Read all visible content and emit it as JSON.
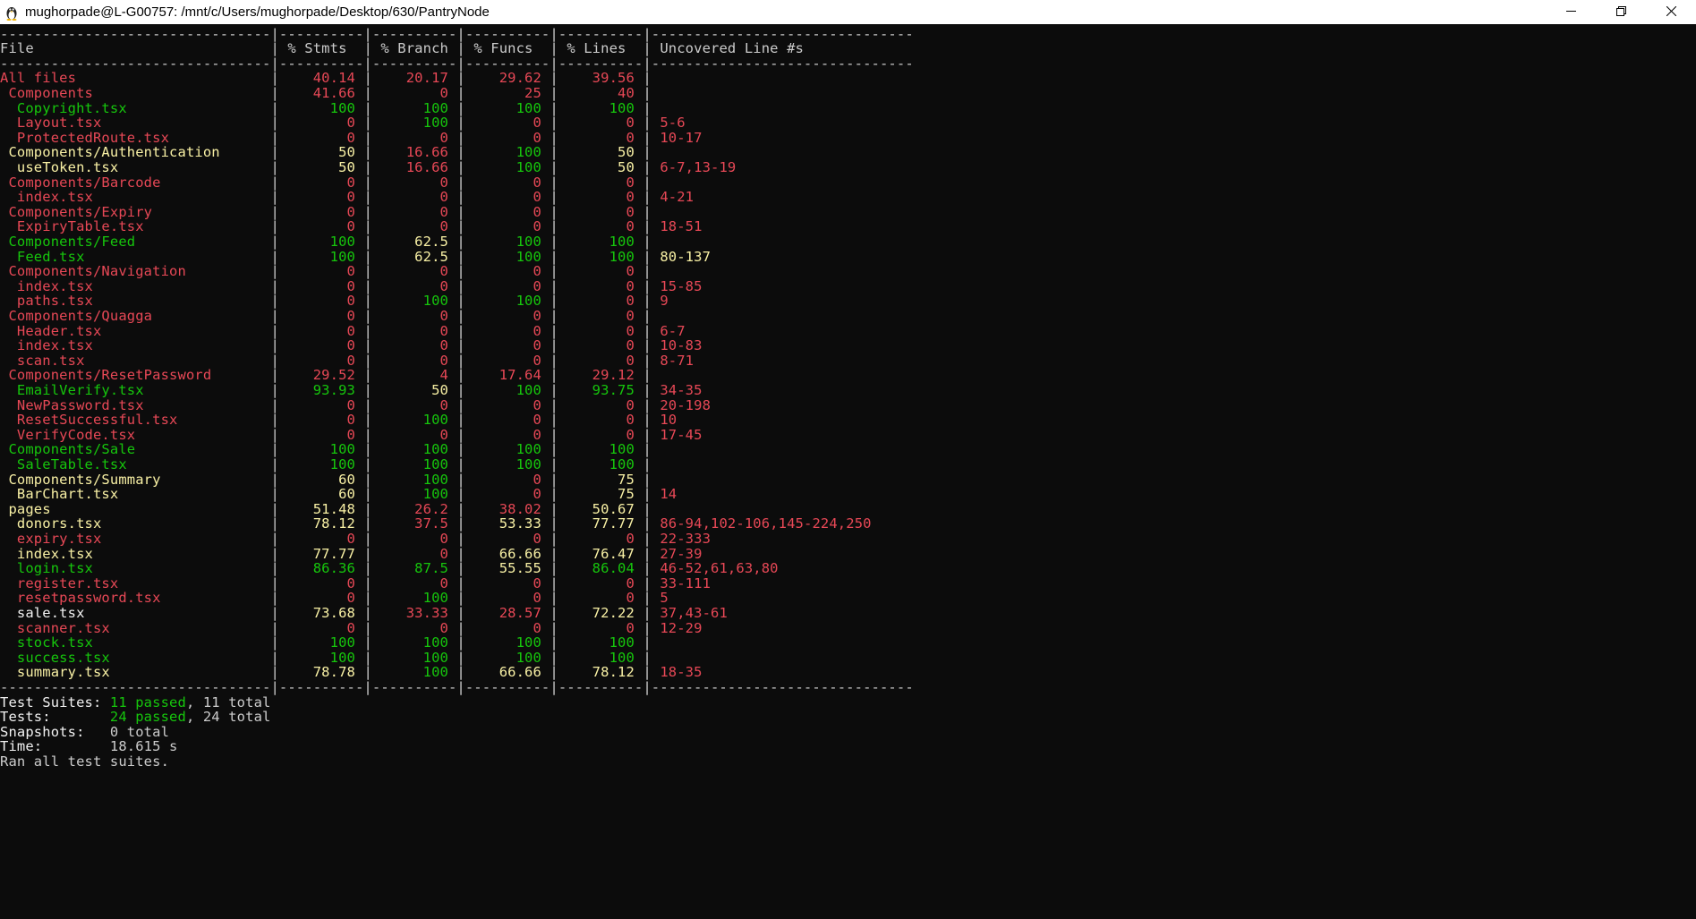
{
  "window": {
    "title": "mughorpade@L-G00757: /mnt/c/Users/mughorpade/Desktop/630/PantryNode",
    "icon": "linux-penguin-icon",
    "controls": [
      "minimize-icon",
      "restore-icon",
      "close-icon"
    ]
  },
  "colors": {
    "red": "#e74856",
    "green": "#16c60c",
    "yellow": "#f9f1a5",
    "white": "#f2f2f2",
    "gray": "#cccccc",
    "background": "#0c0c0c"
  },
  "table": {
    "separator": "--------------------------------|----------|----------|----------|----------|-------------------------------",
    "headers": [
      "File",
      "% Stmts",
      "% Branch",
      "% Funcs",
      "% Lines",
      "Uncovered Line #s"
    ],
    "rows": [
      {
        "file": "All files",
        "indent": 0,
        "c": "red",
        "stmts": "40.14",
        "sc": "red",
        "branch": "20.17",
        "bc": "red",
        "funcs": "29.62",
        "fc": "red",
        "lines": "39.56",
        "lc": "red",
        "uncovered": ""
      },
      {
        "file": "Components",
        "indent": 1,
        "c": "red",
        "stmts": "41.66",
        "sc": "red",
        "branch": "0",
        "bc": "red",
        "funcs": "25",
        "fc": "red",
        "lines": "40",
        "lc": "red",
        "uncovered": ""
      },
      {
        "file": "Copyright.tsx",
        "indent": 2,
        "c": "green",
        "stmts": "100",
        "sc": "green",
        "branch": "100",
        "bc": "green",
        "funcs": "100",
        "fc": "green",
        "lines": "100",
        "lc": "green",
        "uncovered": ""
      },
      {
        "file": "Layout.tsx",
        "indent": 2,
        "c": "red",
        "stmts": "0",
        "sc": "red",
        "branch": "100",
        "bc": "green",
        "funcs": "0",
        "fc": "red",
        "lines": "0",
        "lc": "red",
        "uncovered": "5-6"
      },
      {
        "file": "ProtectedRoute.tsx",
        "indent": 2,
        "c": "red",
        "stmts": "0",
        "sc": "red",
        "branch": "0",
        "bc": "red",
        "funcs": "0",
        "fc": "red",
        "lines": "0",
        "lc": "red",
        "uncovered": "10-17"
      },
      {
        "file": "Components/Authentication",
        "indent": 1,
        "c": "yellow",
        "stmts": "50",
        "sc": "yellow",
        "branch": "16.66",
        "bc": "red",
        "funcs": "100",
        "fc": "green",
        "lines": "50",
        "lc": "yellow",
        "uncovered": ""
      },
      {
        "file": "useToken.tsx",
        "indent": 2,
        "c": "yellow",
        "stmts": "50",
        "sc": "yellow",
        "branch": "16.66",
        "bc": "red",
        "funcs": "100",
        "fc": "green",
        "lines": "50",
        "lc": "yellow",
        "uncovered": "6-7,13-19"
      },
      {
        "file": "Components/Barcode",
        "indent": 1,
        "c": "red",
        "stmts": "0",
        "sc": "red",
        "branch": "0",
        "bc": "red",
        "funcs": "0",
        "fc": "red",
        "lines": "0",
        "lc": "red",
        "uncovered": ""
      },
      {
        "file": "index.tsx",
        "indent": 2,
        "c": "red",
        "stmts": "0",
        "sc": "red",
        "branch": "0",
        "bc": "red",
        "funcs": "0",
        "fc": "red",
        "lines": "0",
        "lc": "red",
        "uncovered": "4-21"
      },
      {
        "file": "Components/Expiry",
        "indent": 1,
        "c": "red",
        "stmts": "0",
        "sc": "red",
        "branch": "0",
        "bc": "red",
        "funcs": "0",
        "fc": "red",
        "lines": "0",
        "lc": "red",
        "uncovered": ""
      },
      {
        "file": "ExpiryTable.tsx",
        "indent": 2,
        "c": "red",
        "stmts": "0",
        "sc": "red",
        "branch": "0",
        "bc": "red",
        "funcs": "0",
        "fc": "red",
        "lines": "0",
        "lc": "red",
        "uncovered": "18-51"
      },
      {
        "file": "Components/Feed",
        "indent": 1,
        "c": "green",
        "stmts": "100",
        "sc": "green",
        "branch": "62.5",
        "bc": "yellow",
        "funcs": "100",
        "fc": "green",
        "lines": "100",
        "lc": "green",
        "uncovered": ""
      },
      {
        "file": "Feed.tsx",
        "indent": 2,
        "c": "green",
        "stmts": "100",
        "sc": "green",
        "branch": "62.5",
        "bc": "yellow",
        "funcs": "100",
        "fc": "green",
        "lines": "100",
        "lc": "green",
        "uncovered": "80-137",
        "uc": "yellow"
      },
      {
        "file": "Components/Navigation",
        "indent": 1,
        "c": "red",
        "stmts": "0",
        "sc": "red",
        "branch": "0",
        "bc": "red",
        "funcs": "0",
        "fc": "red",
        "lines": "0",
        "lc": "red",
        "uncovered": ""
      },
      {
        "file": "index.tsx",
        "indent": 2,
        "c": "red",
        "stmts": "0",
        "sc": "red",
        "branch": "0",
        "bc": "red",
        "funcs": "0",
        "fc": "red",
        "lines": "0",
        "lc": "red",
        "uncovered": "15-85"
      },
      {
        "file": "paths.tsx",
        "indent": 2,
        "c": "red",
        "stmts": "0",
        "sc": "red",
        "branch": "100",
        "bc": "green",
        "funcs": "100",
        "fc": "green",
        "lines": "0",
        "lc": "red",
        "uncovered": "9"
      },
      {
        "file": "Components/Quagga",
        "indent": 1,
        "c": "red",
        "stmts": "0",
        "sc": "red",
        "branch": "0",
        "bc": "red",
        "funcs": "0",
        "fc": "red",
        "lines": "0",
        "lc": "red",
        "uncovered": ""
      },
      {
        "file": "Header.tsx",
        "indent": 2,
        "c": "red",
        "stmts": "0",
        "sc": "red",
        "branch": "0",
        "bc": "red",
        "funcs": "0",
        "fc": "red",
        "lines": "0",
        "lc": "red",
        "uncovered": "6-7"
      },
      {
        "file": "index.tsx",
        "indent": 2,
        "c": "red",
        "stmts": "0",
        "sc": "red",
        "branch": "0",
        "bc": "red",
        "funcs": "0",
        "fc": "red",
        "lines": "0",
        "lc": "red",
        "uncovered": "10-83"
      },
      {
        "file": "scan.tsx",
        "indent": 2,
        "c": "red",
        "stmts": "0",
        "sc": "red",
        "branch": "0",
        "bc": "red",
        "funcs": "0",
        "fc": "red",
        "lines": "0",
        "lc": "red",
        "uncovered": "8-71"
      },
      {
        "file": "Components/ResetPassword",
        "indent": 1,
        "c": "red",
        "stmts": "29.52",
        "sc": "red",
        "branch": "4",
        "bc": "red",
        "funcs": "17.64",
        "fc": "red",
        "lines": "29.12",
        "lc": "red",
        "uncovered": ""
      },
      {
        "file": "EmailVerify.tsx",
        "indent": 2,
        "c": "green",
        "stmts": "93.93",
        "sc": "green",
        "branch": "50",
        "bc": "yellow",
        "funcs": "100",
        "fc": "green",
        "lines": "93.75",
        "lc": "green",
        "uncovered": "34-35"
      },
      {
        "file": "NewPassword.tsx",
        "indent": 2,
        "c": "red",
        "stmts": "0",
        "sc": "red",
        "branch": "0",
        "bc": "red",
        "funcs": "0",
        "fc": "red",
        "lines": "0",
        "lc": "red",
        "uncovered": "20-198"
      },
      {
        "file": "ResetSuccessful.tsx",
        "indent": 2,
        "c": "red",
        "stmts": "0",
        "sc": "red",
        "branch": "100",
        "bc": "green",
        "funcs": "0",
        "fc": "red",
        "lines": "0",
        "lc": "red",
        "uncovered": "10"
      },
      {
        "file": "VerifyCode.tsx",
        "indent": 2,
        "c": "red",
        "stmts": "0",
        "sc": "red",
        "branch": "0",
        "bc": "red",
        "funcs": "0",
        "fc": "red",
        "lines": "0",
        "lc": "red",
        "uncovered": "17-45"
      },
      {
        "file": "Components/Sale",
        "indent": 1,
        "c": "green",
        "stmts": "100",
        "sc": "green",
        "branch": "100",
        "bc": "green",
        "funcs": "100",
        "fc": "green",
        "lines": "100",
        "lc": "green",
        "uncovered": ""
      },
      {
        "file": "SaleTable.tsx",
        "indent": 2,
        "c": "green",
        "stmts": "100",
        "sc": "green",
        "branch": "100",
        "bc": "green",
        "funcs": "100",
        "fc": "green",
        "lines": "100",
        "lc": "green",
        "uncovered": ""
      },
      {
        "file": "Components/Summary",
        "indent": 1,
        "c": "yellow",
        "stmts": "60",
        "sc": "yellow",
        "branch": "100",
        "bc": "green",
        "funcs": "0",
        "fc": "red",
        "lines": "75",
        "lc": "yellow",
        "uncovered": ""
      },
      {
        "file": "BarChart.tsx",
        "indent": 2,
        "c": "yellow",
        "stmts": "60",
        "sc": "yellow",
        "branch": "100",
        "bc": "green",
        "funcs": "0",
        "fc": "red",
        "lines": "75",
        "lc": "yellow",
        "uncovered": "14"
      },
      {
        "file": "pages",
        "indent": 1,
        "c": "yellow",
        "stmts": "51.48",
        "sc": "yellow",
        "branch": "26.2",
        "bc": "red",
        "funcs": "38.02",
        "fc": "red",
        "lines": "50.67",
        "lc": "yellow",
        "uncovered": ""
      },
      {
        "file": "donors.tsx",
        "indent": 2,
        "c": "yellow",
        "stmts": "78.12",
        "sc": "yellow",
        "branch": "37.5",
        "bc": "red",
        "funcs": "53.33",
        "fc": "yellow",
        "lines": "77.77",
        "lc": "yellow",
        "uncovered": "86-94,102-106,145-224,250"
      },
      {
        "file": "expiry.tsx",
        "indent": 2,
        "c": "red",
        "stmts": "0",
        "sc": "red",
        "branch": "0",
        "bc": "red",
        "funcs": "0",
        "fc": "red",
        "lines": "0",
        "lc": "red",
        "uncovered": "22-333"
      },
      {
        "file": "index.tsx",
        "indent": 2,
        "c": "yellow",
        "stmts": "77.77",
        "sc": "yellow",
        "branch": "0",
        "bc": "red",
        "funcs": "66.66",
        "fc": "yellow",
        "lines": "76.47",
        "lc": "yellow",
        "uncovered": "27-39"
      },
      {
        "file": "login.tsx",
        "indent": 2,
        "c": "green",
        "stmts": "86.36",
        "sc": "green",
        "branch": "87.5",
        "bc": "green",
        "funcs": "55.55",
        "fc": "yellow",
        "lines": "86.04",
        "lc": "green",
        "uncovered": "46-52,61,63,80"
      },
      {
        "file": "register.tsx",
        "indent": 2,
        "c": "red",
        "stmts": "0",
        "sc": "red",
        "branch": "0",
        "bc": "red",
        "funcs": "0",
        "fc": "red",
        "lines": "0",
        "lc": "red",
        "uncovered": "33-111"
      },
      {
        "file": "resetpassword.tsx",
        "indent": 2,
        "c": "red",
        "stmts": "0",
        "sc": "red",
        "branch": "100",
        "bc": "green",
        "funcs": "0",
        "fc": "red",
        "lines": "0",
        "lc": "red",
        "uncovered": "5"
      },
      {
        "file": "sale.tsx",
        "indent": 2,
        "c": "white",
        "stmts": "73.68",
        "sc": "yellow",
        "branch": "33.33",
        "bc": "red",
        "funcs": "28.57",
        "fc": "red",
        "lines": "72.22",
        "lc": "yellow",
        "uncovered": "37,43-61"
      },
      {
        "file": "scanner.tsx",
        "indent": 2,
        "c": "red",
        "stmts": "0",
        "sc": "red",
        "branch": "0",
        "bc": "red",
        "funcs": "0",
        "fc": "red",
        "lines": "0",
        "lc": "red",
        "uncovered": "12-29"
      },
      {
        "file": "stock.tsx",
        "indent": 2,
        "c": "green",
        "stmts": "100",
        "sc": "green",
        "branch": "100",
        "bc": "green",
        "funcs": "100",
        "fc": "green",
        "lines": "100",
        "lc": "green",
        "uncovered": ""
      },
      {
        "file": "success.tsx",
        "indent": 2,
        "c": "green",
        "stmts": "100",
        "sc": "green",
        "branch": "100",
        "bc": "green",
        "funcs": "100",
        "fc": "green",
        "lines": "100",
        "lc": "green",
        "uncovered": ""
      },
      {
        "file": "summary.tsx",
        "indent": 2,
        "c": "yellow",
        "stmts": "78.78",
        "sc": "yellow",
        "branch": "100",
        "bc": "green",
        "funcs": "66.66",
        "fc": "yellow",
        "lines": "78.12",
        "lc": "yellow",
        "uncovered": "18-35"
      }
    ]
  },
  "summary": [
    {
      "label": "Test Suites:",
      "parts": [
        {
          "text": "11 passed",
          "c": "green"
        },
        {
          "text": ", 11 total",
          "c": "gray"
        }
      ]
    },
    {
      "label": "Tests:",
      "parts": [
        {
          "text": "24 passed",
          "c": "green"
        },
        {
          "text": ", 24 total",
          "c": "gray"
        }
      ]
    },
    {
      "label": "Snapshots:",
      "parts": [
        {
          "text": "0 total",
          "c": "gray"
        }
      ]
    },
    {
      "label": "Time:",
      "parts": [
        {
          "text": "18.615 s",
          "c": "gray"
        }
      ]
    }
  ],
  "footer": "Ran all test suites."
}
